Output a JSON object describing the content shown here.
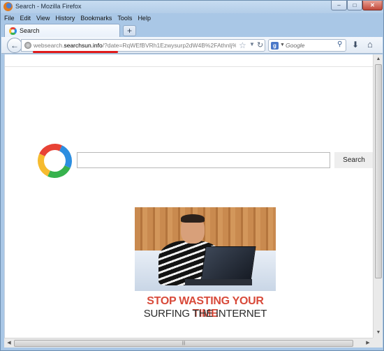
{
  "window": {
    "title": "Search - Mozilla Firefox"
  },
  "menu": {
    "items": [
      {
        "label": "File"
      },
      {
        "label": "Edit"
      },
      {
        "label": "View"
      },
      {
        "label": "History"
      },
      {
        "label": "Bookmarks"
      },
      {
        "label": "Tools"
      },
      {
        "label": "Help"
      }
    ]
  },
  "tab": {
    "label": "Search",
    "new_tab_symbol": "+"
  },
  "urlbar": {
    "url_prefix": "websearch.",
    "url_domain": "searchsun.info",
    "url_rest": "/?date=RqWEfBVRh1Ezwysurp2dW4B%2FAthnIj%2BD&"
  },
  "searchbar": {
    "placeholder": "Google",
    "engine_letter": "g"
  },
  "content": {
    "search_button_label": "Search",
    "ad": {
      "headline": "STOP WASTING YOUR TIME",
      "subline": "SURFING THE INTERNET"
    }
  },
  "colors": {
    "url_highlight": "#e01b1b",
    "ad_headline": "#d84a3a"
  }
}
